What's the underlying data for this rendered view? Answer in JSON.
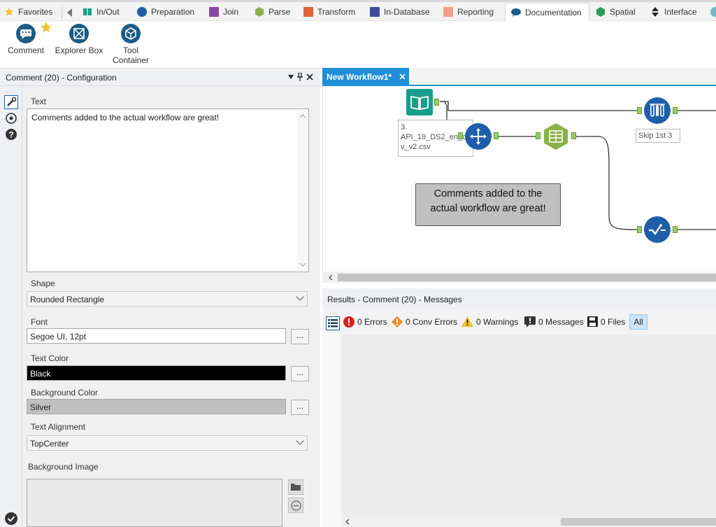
{
  "tabs": [
    {
      "label": "Favorites",
      "icon": "star-icon",
      "color": "#f2c12e"
    },
    {
      "label": "In/Out",
      "icon": "book-icon",
      "color": "#1a9e8c"
    },
    {
      "label": "Preparation",
      "icon": "circle-icon",
      "color": "#1f5faa"
    },
    {
      "label": "Join",
      "icon": "square-icon",
      "color": "#8a4aa3"
    },
    {
      "label": "Parse",
      "icon": "hexagon-icon",
      "color": "#8ab04a"
    },
    {
      "label": "Transform",
      "icon": "square-icon",
      "color": "#e0623a"
    },
    {
      "label": "In-Database",
      "icon": "square-icon",
      "color": "#3d4b9c"
    },
    {
      "label": "Reporting",
      "icon": "square-icon",
      "color": "#e8a48a"
    },
    {
      "label": "Documentation",
      "icon": "speech-bubble-icon",
      "color": "#1c5b86"
    },
    {
      "label": "Spatial",
      "icon": "hexagon-icon",
      "color": "#2d9e5a"
    },
    {
      "label": "Interface",
      "icon": "diamond-icon",
      "color": "#222222"
    }
  ],
  "ribbon": {
    "tools": [
      {
        "label": "Comment",
        "icon": "comment-icon"
      },
      {
        "label": "Explorer Box",
        "icon": "explorer-box-icon"
      },
      {
        "label_line1": "Tool",
        "label_line2": "Container",
        "icon": "tool-container-icon"
      }
    ]
  },
  "config": {
    "title": "Comment (20) - Configuration",
    "text_label": "Text",
    "text_value": "Comments added to the actual workflow are great!",
    "shape_label": "Shape",
    "shape_value": "Rounded Rectangle",
    "font_label": "Font",
    "font_value": "Segoe UI, 12pt",
    "font_button": "...",
    "text_color_label": "Text Color",
    "text_color_value": "Black",
    "text_color_button": "...",
    "bg_color_label": "Background Color",
    "bg_color_value": "Silver",
    "bg_color_button": "...",
    "align_label": "Text Alignment",
    "align_value": "TopCenter",
    "bg_image_label": "Background Image"
  },
  "canvas": {
    "tab_label": "New Workflow1*",
    "input_label_line1": "3.",
    "input_label_line2": "API_19_DS2_en_c",
    "input_label_line3": "v_v2.csv",
    "skip_label": "Skip 1st 3",
    "comment_line1": "Comments added to the",
    "comment_line2": "actual workflow are great!"
  },
  "results": {
    "title": "Results - Comment (20) - Messages",
    "errors": "0 Errors",
    "conv_errors": "0 Conv Errors",
    "warnings": "0 Warnings",
    "messages": "0 Messages",
    "files": "0 Files",
    "all": "All"
  },
  "colors": {
    "accent": "#1f8fd8",
    "tool_blue": "#1c5b86",
    "tool_teal": "#1a9e8c",
    "tool_green": "#8ab04a"
  }
}
